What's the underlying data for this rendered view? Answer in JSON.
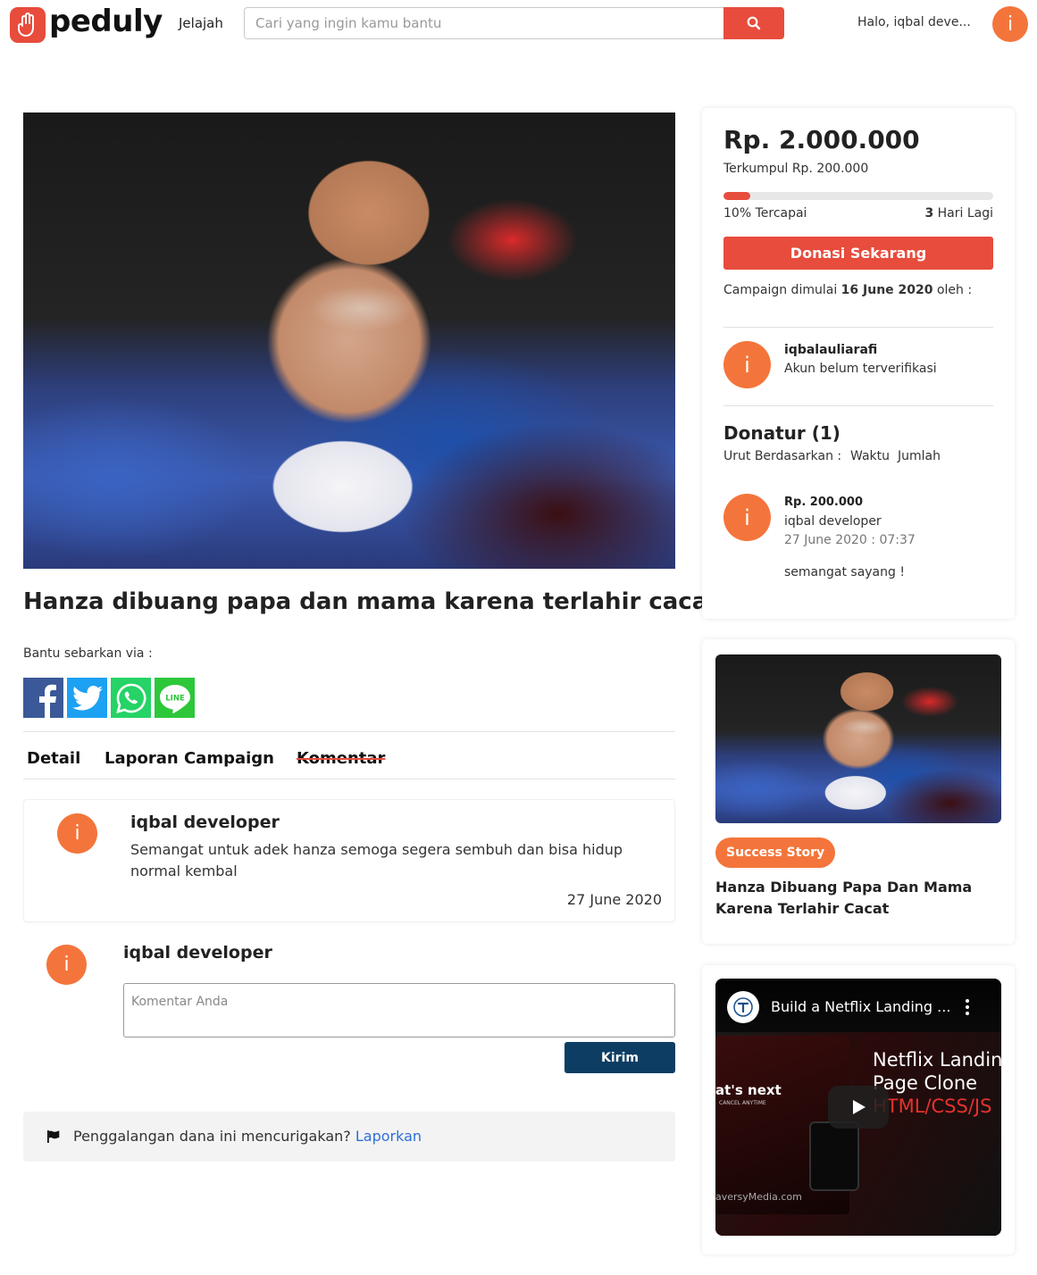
{
  "header": {
    "brand": "peduly",
    "nav_jelajah": "Jelajah",
    "search_placeholder": "Cari yang ingin kamu bantu",
    "greeting": "Halo, iqbal deve...",
    "avatar_letter": "i"
  },
  "campaign": {
    "title": "Hanza dibuang papa dan mama karena terlahir cacat",
    "share_label": "Bantu sebarkan via :",
    "share_buttons": [
      "facebook-icon",
      "twitter-icon",
      "whatsapp-icon",
      "line-icon"
    ]
  },
  "tabs": [
    "Detail",
    "Laporan Campaign",
    "Komentar"
  ],
  "comments": [
    {
      "avatar": "i",
      "name": "iqbal developer",
      "text": "Semangat untuk adek hanza semoga segera sembuh dan bisa hidup normal kembal",
      "date": "27 June 2020"
    }
  ],
  "comment_form": {
    "avatar": "i",
    "name": "iqbal developer",
    "placeholder": "Komentar Anda",
    "submit_label": "Kirim"
  },
  "report": {
    "text": "Penggalangan dana ini mencurigakan?",
    "link": "Laporkan"
  },
  "donation": {
    "target": "Rp. 2.000.000",
    "collected": "Terkumpul Rp. 200.000",
    "percent_label": "10%",
    "reached_label": "Tercapai",
    "progress_percent": 10,
    "days_number": "3",
    "days_label": "Hari Lagi",
    "button_label": "Donasi Sekarang",
    "started_prefix": "Campaign dimulai",
    "started_date": "16 June 2020",
    "started_suffix": "oleh :"
  },
  "organizer": {
    "avatar": "i",
    "name": "iqbalauliarafi",
    "status": "Akun belum terverifikasi"
  },
  "donors": {
    "heading": "Donatur (1)",
    "sort_label": "Urut Berdasarkan :",
    "sort_options": [
      "Waktu",
      "Jumlah"
    ],
    "list": [
      {
        "avatar": "i",
        "amount": "Rp. 200.000",
        "name": "iqbal developer",
        "time": "27 June 2020 : 07:37",
        "message": "semangat sayang !"
      }
    ]
  },
  "related": {
    "badge": "Success Story",
    "title": "Hanza Dibuang Papa Dan Mama Karena Terlahir Cacat"
  },
  "video": {
    "title": "Build a Netflix Landing ...",
    "overlay_line1": "Netflix Landing",
    "overlay_line2": "Page Clone",
    "overlay_line3": "HTML/CSS/JS",
    "small_text": "at's next",
    "small_sub": "CANCEL ANYTIME",
    "bottom_text": "aversyMedia.com"
  },
  "colors": {
    "brand_red": "#e74c3c",
    "avatar_orange": "#f4753b",
    "navy_button": "#0d3d63",
    "link_blue": "#2e6fd8"
  }
}
